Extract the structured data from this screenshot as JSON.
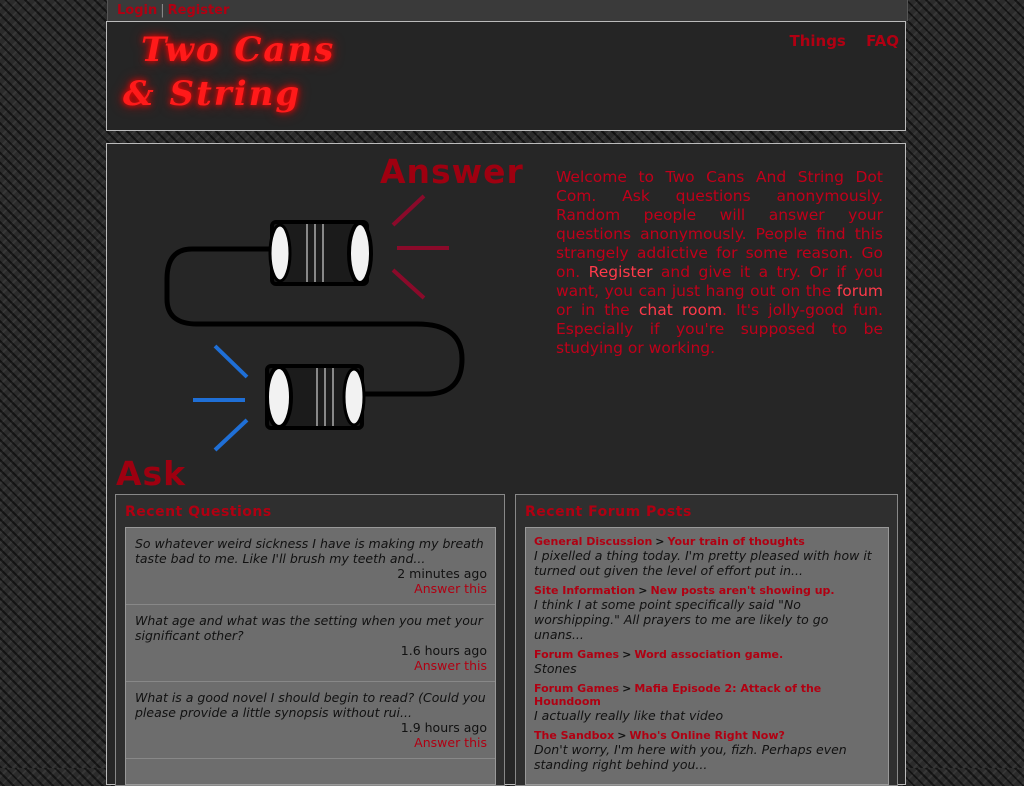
{
  "topbar": {
    "login": "Login",
    "separator": "|",
    "register": "Register"
  },
  "header": {
    "logo_line1": "Two Cans",
    "logo_line2": "& String",
    "nav": [
      "Things",
      "FAQ"
    ]
  },
  "hero": {
    "answer_label": "Answer",
    "ask_label": "Ask",
    "welcome": {
      "part1": "Welcome to Two Cans And String Dot Com. Ask questions anonymously. Random people will answer your questions anonymously. People find this strangely addictive for some reason. Go on. ",
      "register_link": "Register",
      "part2": " and give it a try. Or if you want, you can just hang out on the ",
      "forum_link": "forum",
      "part3": " or in the ",
      "chat_link": "chat room",
      "part4": ". It's jolly-good fun. Especially if you're supposed to be studying or working."
    }
  },
  "recent_questions": {
    "title": "Recent Questions",
    "items": [
      {
        "text": "So whatever weird sickness I have is making my breath taste bad to me. Like I'll brush my teeth and...",
        "time": "2 minutes ago",
        "action": "Answer this"
      },
      {
        "text": "What age and what was the setting when you met your significant other?",
        "time": "1.6 hours ago",
        "action": "Answer this"
      },
      {
        "text": "What is a good novel I should begin to read? (Could you please provide a little synopsis without rui...",
        "time": "1.9 hours ago",
        "action": "Answer this"
      }
    ]
  },
  "recent_posts": {
    "title": "Recent Forum Posts",
    "items": [
      {
        "forum": "General Discussion",
        "thread": "Your train of thoughts",
        "excerpt": "I pixelled a thing today. I'm pretty pleased with how it turned out given the level of effort put in..."
      },
      {
        "forum": "Site Information",
        "thread": "New posts aren't showing up.",
        "excerpt": "I think I at some point specifically said \"No worshipping.\" All prayers to me are likely to go unans..."
      },
      {
        "forum": "Forum Games",
        "thread": "Word association game.",
        "excerpt": "Stones"
      },
      {
        "forum": "Forum Games",
        "thread": "Mafia Episode 2: Attack of the Houndoom",
        "excerpt": "I actually really like that video"
      },
      {
        "forum": "The Sandbox",
        "thread": "Who's Online Right Now?",
        "excerpt": "Don't worry, I'm here with you, fizh. Perhaps even standing right behind you..."
      }
    ],
    "gt": ">"
  },
  "colors": {
    "accent_red": "#b00012",
    "logo_red": "#ff1a1a",
    "signal_red": "#8a0a2a",
    "signal_blue": "#1f6fd6"
  }
}
